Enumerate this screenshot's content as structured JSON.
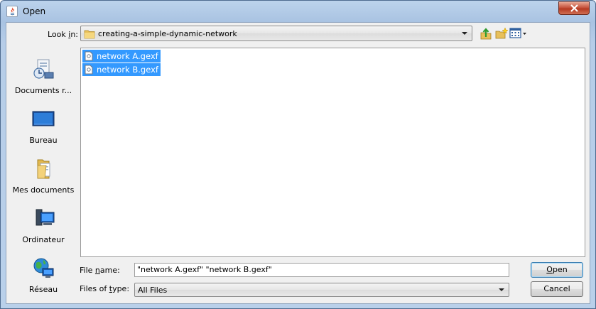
{
  "window": {
    "title": "Open"
  },
  "toolbar": {
    "look_in_label_pre": "Look ",
    "look_in_label_mnemonic": "i",
    "look_in_label_post": "n:",
    "look_in_value": "creating-a-simple-dynamic-network",
    "icons": [
      "up-one-level-icon",
      "new-folder-icon",
      "view-menu-icon"
    ]
  },
  "places": [
    {
      "label": "Documents r...",
      "icon": "recent-documents-icon"
    },
    {
      "label": "Bureau",
      "icon": "desktop-icon"
    },
    {
      "label": "Mes documents",
      "icon": "my-documents-icon"
    },
    {
      "label": "Ordinateur",
      "icon": "computer-icon"
    },
    {
      "label": "Réseau",
      "icon": "network-icon"
    }
  ],
  "files": [
    {
      "name": "network A.gexf",
      "selected": true
    },
    {
      "name": "network B.gexf",
      "selected": true
    }
  ],
  "file_name": {
    "label_pre": "File ",
    "label_mnemonic": "n",
    "label_post": "ame:",
    "value": "\"network A.gexf\" \"network B.gexf\""
  },
  "file_type": {
    "label_pre": "Files of ",
    "label_mnemonic": "t",
    "label_post": "ype:",
    "value": "All Files"
  },
  "buttons": {
    "open_mnemonic": "O",
    "open_rest": "pen",
    "cancel": "Cancel"
  },
  "colors": {
    "selection": "#3399ff",
    "close_button": "#c7543e"
  }
}
